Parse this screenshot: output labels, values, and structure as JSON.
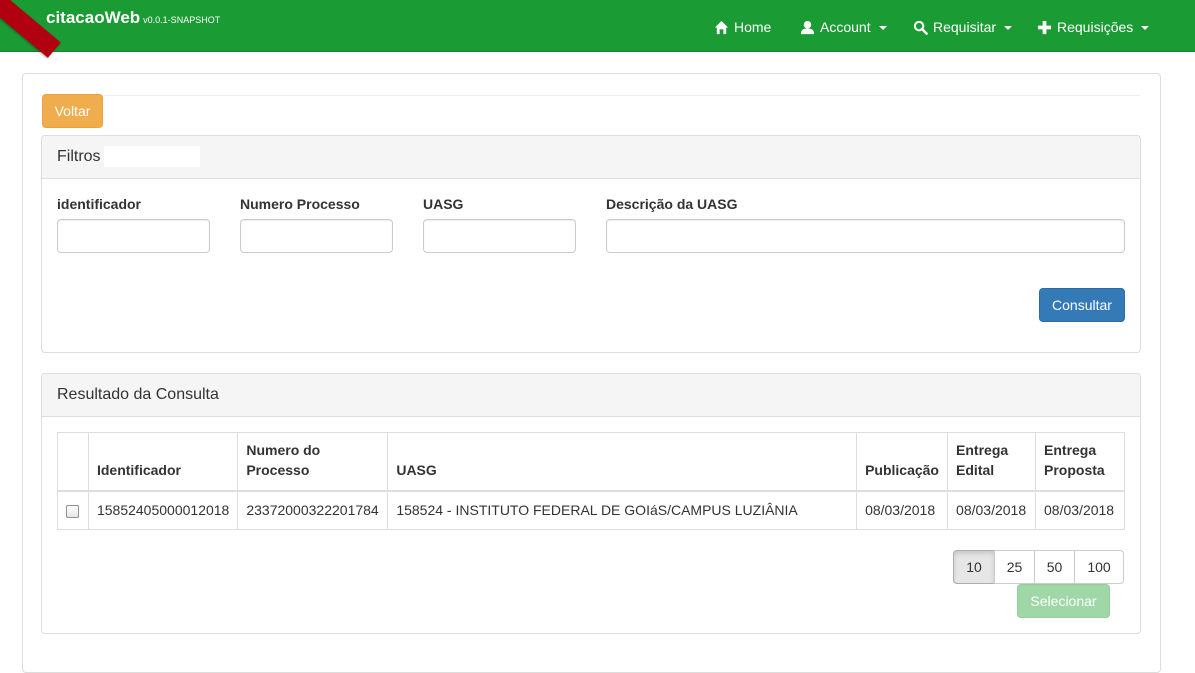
{
  "navbar": {
    "brand": "citacaoWeb",
    "version": "v0.0.1-SNAPSHOT",
    "items": [
      {
        "label": "Home",
        "icon": "home-icon"
      },
      {
        "label": "Account",
        "icon": "user-icon"
      },
      {
        "label": "Requisitar",
        "icon": "search-icon"
      },
      {
        "label": "Requisições",
        "icon": "plus-icon"
      }
    ],
    "color": "#1a9b34"
  },
  "actions": {
    "voltar_label": "Voltar",
    "consultar_label": "Consultar",
    "selecionar_label": "Selecionar"
  },
  "filtros": {
    "title": "Filtros",
    "fields": [
      {
        "label": "identificador",
        "value": ""
      },
      {
        "label": "Numero Processo",
        "value": ""
      },
      {
        "label": "UASG",
        "value": ""
      },
      {
        "label": "Descrição da UASG",
        "value": ""
      }
    ]
  },
  "resultado": {
    "title": "Resultado da Consulta",
    "columns": [
      "",
      "Identificador",
      "Numero do Processo",
      "UASG",
      "Publicação",
      "Entrega Edital",
      "Entrega Proposta"
    ],
    "rows": [
      {
        "checked": false,
        "identificador": "15852405000012018",
        "processo": "23372000322201784",
        "uasg": "158524 - INSTITUTO FEDERAL DE GOIáS/CAMPUS LUZIÂNIA",
        "publicacao": "08/03/2018",
        "entrega_edital": "08/03/2018",
        "entrega_proposta": "08/03/2018"
      }
    ],
    "page_sizes": [
      "10",
      "25",
      "50",
      "100"
    ],
    "selected_page_size": "10"
  }
}
